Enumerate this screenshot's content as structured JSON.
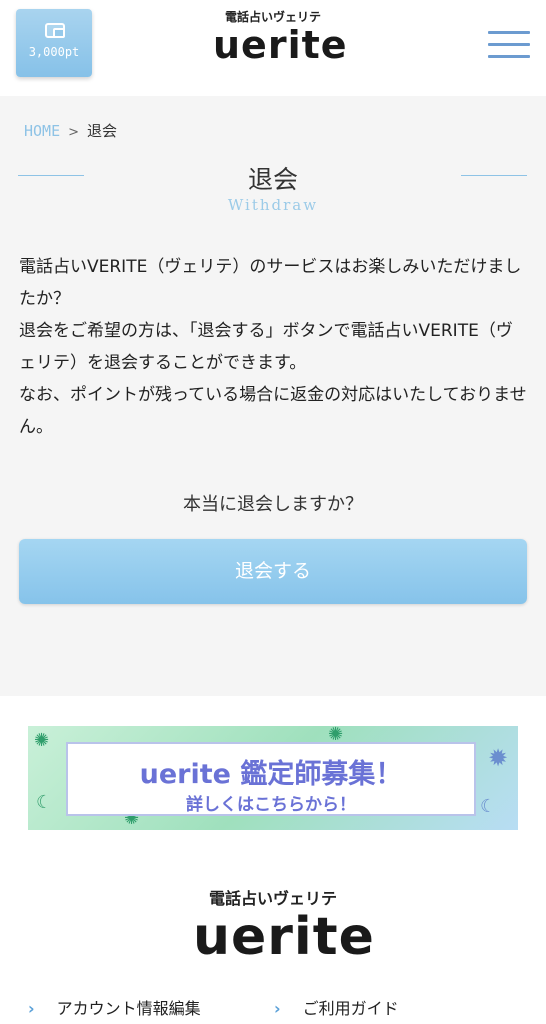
{
  "header": {
    "points": "3,000pt",
    "logo_sub": "電話占いヴェリテ",
    "logo_main": "uerite"
  },
  "breadcrumb": {
    "home": "HOME",
    "separator": ">",
    "current": "退会"
  },
  "page": {
    "title": "退会",
    "subtitle": "Withdraw",
    "body": [
      "電話占いVERITE（ヴェリテ）のサービスはお楽しみいただけましたか？",
      "退会をご希望の方は、「退会する」ボタンで電話占いVERITE（ヴェリテ）を退会することができます。",
      "なお、ポイントが残っている場合に返金の対応はいたしておりません。"
    ],
    "confirm": "本当に退会しますか？",
    "button": "退会する"
  },
  "banner": {
    "line1": "uerite 鑑定師募集！",
    "line2": "詳しくはこちらから！"
  },
  "footer": {
    "logo_sub": "電話占いヴェリテ",
    "logo_main": "uerite",
    "links": [
      "アカウント情報編集",
      "ご利用ガイド"
    ]
  },
  "colors": {
    "accent": "#8ec3e6",
    "button": "#96cdee",
    "menu": "#6c9bd0",
    "banner_text": "#6a72d6"
  },
  "icons": [
    "wallet-icon",
    "menu-icon",
    "chevron-right-icon"
  ]
}
